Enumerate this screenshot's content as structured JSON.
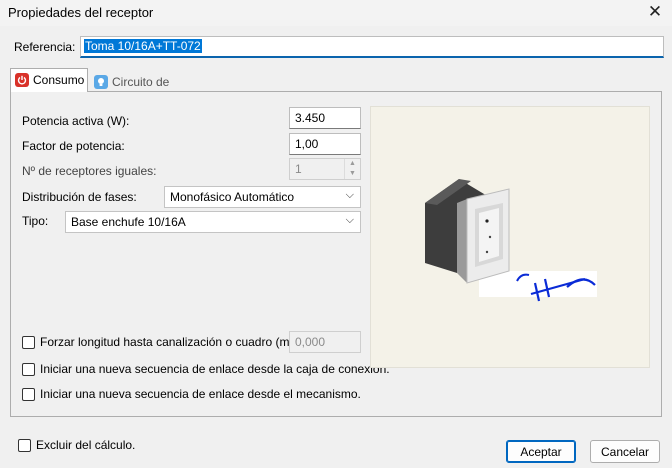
{
  "window": {
    "title": "Propiedades del receptor",
    "close_glyph": "✕"
  },
  "referencia": {
    "label": "Referencia:",
    "value": "Toma 10/16A+TT-072"
  },
  "tabs": [
    {
      "label": "Consumo",
      "icon": "power-icon",
      "active": true
    },
    {
      "label": "Circuito de alimentación",
      "icon": "bulb-icon",
      "active": false
    }
  ],
  "consumo": {
    "potencia": {
      "label": "Potencia activa (W):",
      "value": "3.450"
    },
    "factor": {
      "label": "Factor de potencia:",
      "value": "1,00"
    },
    "receptores": {
      "label": "Nº de receptores iguales:",
      "value": "1"
    },
    "distribucion": {
      "label": "Distribución de fases:",
      "value": "Monofásico Automático"
    },
    "tipo": {
      "label": "Tipo:",
      "value": "Base enchufe 10/16A"
    },
    "forzar": {
      "label": "Forzar longitud hasta canalización o cuadro (m):",
      "value": "0,000",
      "checked": false
    },
    "secuencia_caja": {
      "label": "Iniciar una nueva secuencia de enlace desde la caja de conexión.",
      "checked": false
    },
    "secuencia_mecanismo": {
      "label": "Iniciar una nueva secuencia de enlace desde el mecanismo.",
      "checked": false
    }
  },
  "footer": {
    "excluir": {
      "label": "Excluir del cálculo.",
      "checked": false
    },
    "aceptar": "Aceptar",
    "cancelar": "Cancelar"
  },
  "colors": {
    "accent": "#0078d7",
    "preview_bg": "#f4f2e8",
    "symbol": "#0a2bd6"
  }
}
